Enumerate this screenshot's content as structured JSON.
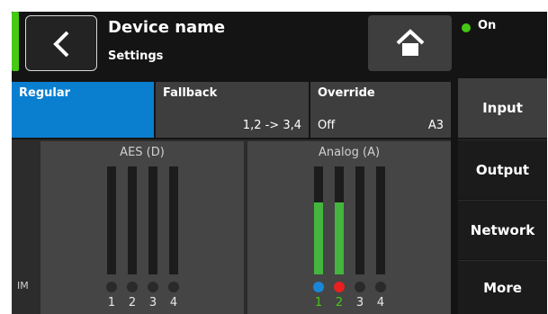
{
  "header": {
    "title": "Device name",
    "subtitle": "Settings",
    "power_label": "On"
  },
  "modes": [
    {
      "label": "Regular",
      "value": "",
      "selected": true
    },
    {
      "label": "Fallback",
      "value": "1,2 -> 3,4",
      "selected": false
    },
    {
      "label": "Override",
      "value_left": "Off",
      "value_right": "A3",
      "selected": false
    }
  ],
  "nav": {
    "items": [
      {
        "label": "Input",
        "active": true
      },
      {
        "label": "Output",
        "active": false
      },
      {
        "label": "Network",
        "active": false
      },
      {
        "label": "More",
        "active": false
      }
    ]
  },
  "meters": {
    "side_label": "IM",
    "groups": [
      {
        "title": "AES (D)",
        "channels": [
          {
            "number": "1",
            "level": 0,
            "dot": "off",
            "number_color": "#e8e8e8"
          },
          {
            "number": "2",
            "level": 0,
            "dot": "off",
            "number_color": "#e8e8e8"
          },
          {
            "number": "3",
            "level": 0,
            "dot": "off",
            "number_color": "#e8e8e8"
          },
          {
            "number": "4",
            "level": 0,
            "dot": "off",
            "number_color": "#e8e8e8"
          }
        ]
      },
      {
        "title": "Analog (A)",
        "channels": [
          {
            "number": "1",
            "level": 0.67,
            "dot": "#1a86d8",
            "number_color": "#46c814"
          },
          {
            "number": "2",
            "level": 0.67,
            "dot": "#e82020",
            "number_color": "#46c814"
          },
          {
            "number": "3",
            "level": 0,
            "dot": "off",
            "number_color": "#e8e8e8"
          },
          {
            "number": "4",
            "level": 0,
            "dot": "off",
            "number_color": "#e8e8e8"
          }
        ]
      }
    ]
  },
  "colors": {
    "accent": "#0a7fd0",
    "status_green": "#46c814",
    "meter_green": "#44b53e"
  },
  "icons": {
    "back": "chevron-left-icon",
    "home": "home-icon"
  }
}
